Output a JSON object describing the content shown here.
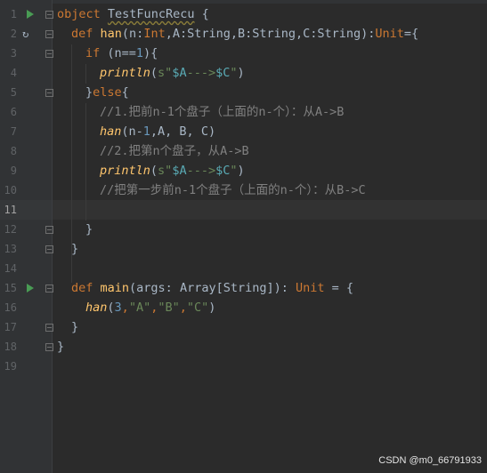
{
  "editor": {
    "language": "Scala",
    "current_line": 11,
    "lines": [
      {
        "n": "1",
        "kind": "obj"
      },
      {
        "n": "2",
        "kind": "def_han"
      },
      {
        "n": "3",
        "kind": "if"
      },
      {
        "n": "4",
        "kind": "println"
      },
      {
        "n": "5",
        "kind": "else"
      },
      {
        "n": "6",
        "kind": "comment",
        "text": "//1.把前n-1个盘子（上面的n-个）：从A->B"
      },
      {
        "n": "7",
        "kind": "call_han1"
      },
      {
        "n": "8",
        "kind": "comment",
        "text": "//2.把第n个盘子，从A->B"
      },
      {
        "n": "9",
        "kind": "println"
      },
      {
        "n": "10",
        "kind": "comment",
        "text": "//把第一步前n-1个盘子（上面的n-个）：从B->C"
      },
      {
        "n": "11",
        "kind": "empty"
      },
      {
        "n": "12",
        "kind": "close_inner"
      },
      {
        "n": "13",
        "kind": "close_def"
      },
      {
        "n": "14",
        "kind": "empty"
      },
      {
        "n": "15",
        "kind": "def_main"
      },
      {
        "n": "16",
        "kind": "call_han_main"
      },
      {
        "n": "17",
        "kind": "close_def"
      },
      {
        "n": "18",
        "kind": "close_obj"
      },
      {
        "n": "19",
        "kind": "empty"
      }
    ],
    "tokens": {
      "object_kw": "object",
      "object_name": "TestFuncRecu",
      "open_brace": " {",
      "def_kw": "def",
      "han_name": "han",
      "han_params_1": "(n:",
      "int_type": "Int",
      "han_params_2": ",A:String,B:String,C:String):",
      "unit_type": "Unit",
      "han_eq": "={",
      "if_kw": "if",
      "if_cond_1": " (n==",
      "if_num": "1",
      "if_cond_2": "){",
      "println_name": "println",
      "println_open": "(",
      "str_s": "s\"",
      "dollar": "$",
      "var_a": "A",
      "arrow": "--->",
      "var_c": "C",
      "str_end": "\"",
      "println_close": ")",
      "else_open": "}",
      "else_kw": "else",
      "else_brace": "{",
      "call_han1_args_1": "(n-",
      "call_han1_num": "1",
      "call_han1_args_2": ",A, B, C)",
      "close_brace": "}",
      "main_name": "main",
      "main_params": "(args: Array[String]): ",
      "main_eq": " = {",
      "call_main_open": "(",
      "call_main_num": "3",
      "call_main_comma": ",",
      "str_a": "\"A\"",
      "str_b": "\"B\"",
      "str_c": "\"C\"",
      "call_main_close": ")"
    }
  },
  "watermark": "CSDN @m0_66791933",
  "colors": {
    "background": "#2b2b2b",
    "gutter": "#313335",
    "keyword": "#cc7832",
    "function": "#ffc66d",
    "string": "#6a8759",
    "number": "#6897bb",
    "comment": "#808080",
    "text": "#a9b7c6",
    "run_icon": "#499c54"
  }
}
